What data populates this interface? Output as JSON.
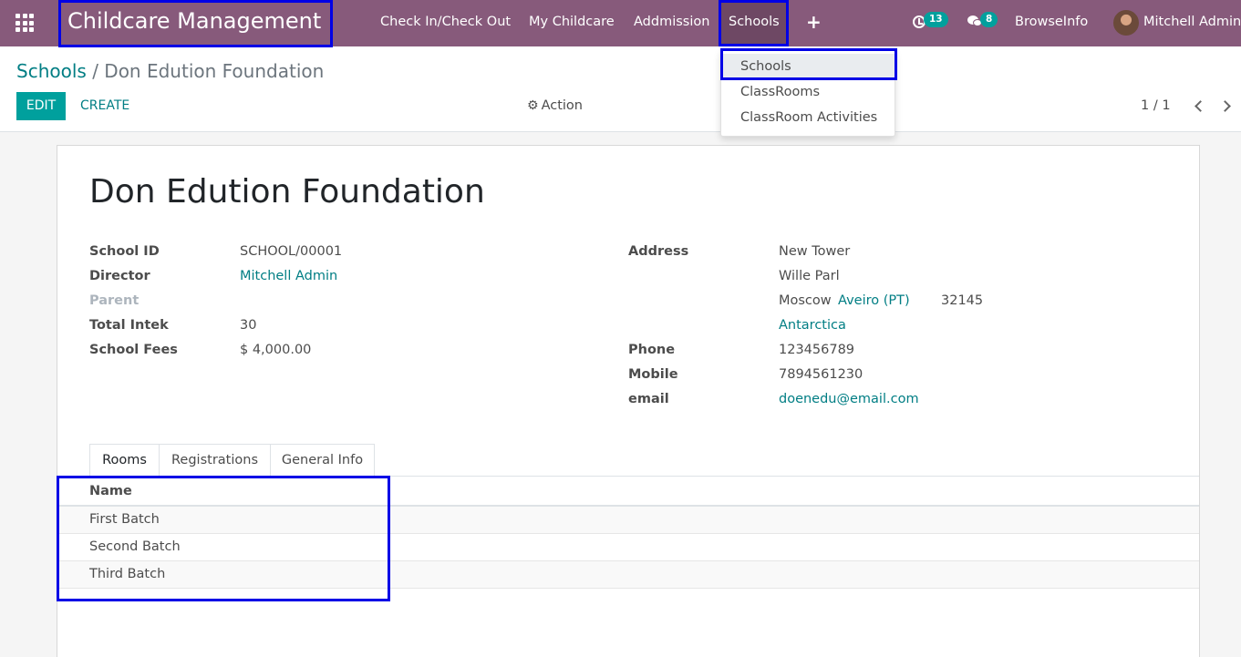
{
  "navbar": {
    "brand": "Childcare Management",
    "items": [
      "Check In/Check Out",
      "My Childcare",
      "Addmission",
      "Schools"
    ],
    "plus": "+",
    "activities_count": "13",
    "messages_count": "8",
    "browseinfo": "BrowseInfo",
    "user_name": "Mitchell Admin"
  },
  "dropdown": {
    "items": [
      "Schools",
      "ClassRooms",
      "ClassRoom Activities"
    ]
  },
  "breadcrumb": {
    "parent": "Schools",
    "separator": "/",
    "current": "Don Edution Foundation"
  },
  "buttons": {
    "edit": "EDIT",
    "create": "CREATE",
    "action": "Action"
  },
  "pager": {
    "value": "1 / 1"
  },
  "record": {
    "title": "Don Edution Foundation",
    "left_fields": [
      {
        "label": "School ID",
        "value": "SCHOOL/00001"
      },
      {
        "label": "Director",
        "value": "Mitchell Admin"
      },
      {
        "label": "Parent",
        "value": ""
      },
      {
        "label": "Total Intek",
        "value": "30"
      },
      {
        "label": "School Fees",
        "value": "$ 4,000.00"
      }
    ],
    "address_label": "Address",
    "street": "New Tower",
    "street2": "Wille Parl",
    "city": "Moscow",
    "state": "Aveiro (PT)",
    "zip": "32145",
    "country": "Antarctica",
    "phone_label": "Phone",
    "phone": "123456789",
    "mobile_label": "Mobile",
    "mobile": "7894561230",
    "email_label": "email",
    "email": "doenedu@email.com"
  },
  "tabs": [
    "Rooms",
    "Registrations",
    "General Info"
  ],
  "rooms_table": {
    "header": "Name",
    "rows": [
      "First Batch",
      "Second Batch",
      "Third Batch"
    ]
  },
  "colors": {
    "navbar": "#875a7b",
    "accent": "#00a09d",
    "link": "#017e84",
    "highlight": "#0000e6"
  }
}
